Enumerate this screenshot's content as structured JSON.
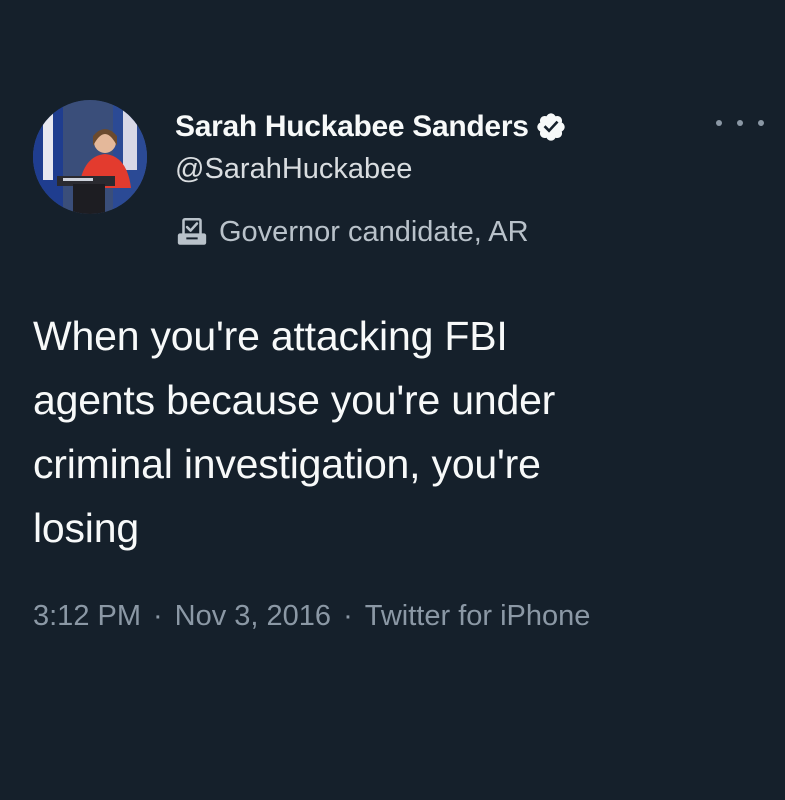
{
  "author": {
    "display_name": "Sarah Huckabee Sanders",
    "handle": "@SarahHuckabee",
    "verified": true,
    "label": "Governor candidate, AR"
  },
  "tweet": {
    "text": "When you're attacking FBI\nagents because you're under\ncriminal investigation, you're\nlosing",
    "time": "3:12 PM",
    "date": "Nov 3, 2016",
    "source": "Twitter for iPhone",
    "separator": "·"
  },
  "icons": {
    "verified": "verified-badge-icon",
    "label": "ballot-box-icon",
    "more": "more-horizontal-icon"
  },
  "colors": {
    "background": "#15202b",
    "primary_text": "#f7f9f9",
    "secondary_text": "#8b98a5"
  }
}
